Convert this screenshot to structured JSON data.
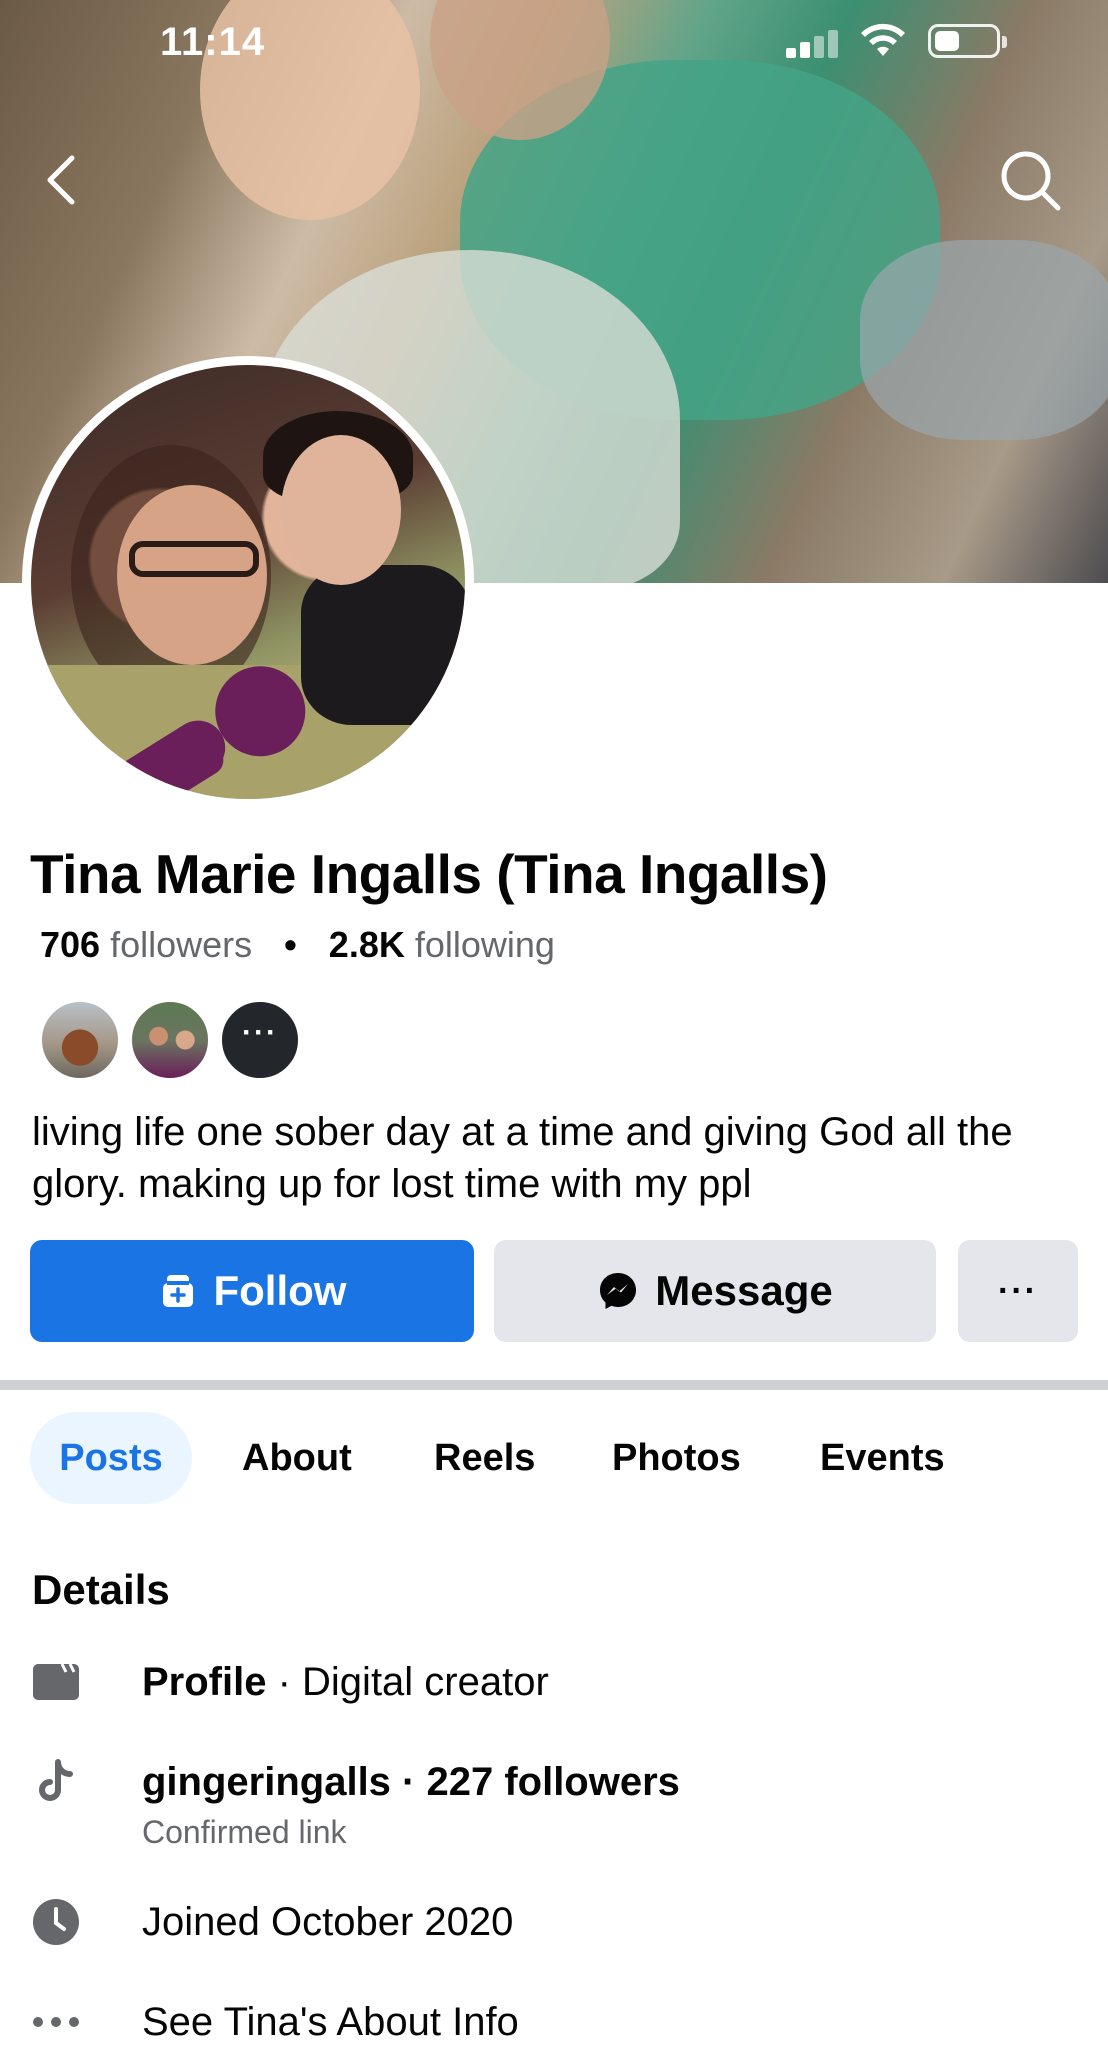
{
  "status_bar": {
    "time": "11:14"
  },
  "profile": {
    "name": "Tina Marie Ingalls (Tina Ingalls)",
    "followers_count": "706",
    "followers_label": "followers",
    "following_count": "2.8K",
    "following_label": "following",
    "separator": "•",
    "mutuals_more": "···",
    "bio": "living life one sober day at a time and giving God all the glory. making up for lost time with my ppl"
  },
  "actions": {
    "follow_label": "Follow",
    "message_label": "Message",
    "more_label": "···"
  },
  "tabs": [
    {
      "label": "Posts",
      "active": true
    },
    {
      "label": "About",
      "active": false
    },
    {
      "label": "Reels",
      "active": false
    },
    {
      "label": "Photos",
      "active": false
    },
    {
      "label": "Events",
      "active": false
    }
  ],
  "details": {
    "title": "Details",
    "profile_type_bold": "Profile",
    "profile_type_rest": " · Digital creator",
    "tiktok_line": "gingeringalls · 227 followers",
    "tiktok_sub": "Confirmed link",
    "joined": "Joined October 2020",
    "see_about": "See Tina's About Info"
  },
  "colors": {
    "accent": "#1b74e4",
    "secondary_button": "#e4e6eb",
    "muted_text": "#65676b",
    "active_tab_bg": "#ebf5ff"
  },
  "icons": [
    "back-icon",
    "search-icon",
    "follow-icon",
    "messenger-icon",
    "more-icon",
    "page-icon",
    "tiktok-icon",
    "clock-icon",
    "ellipsis-icon"
  ]
}
